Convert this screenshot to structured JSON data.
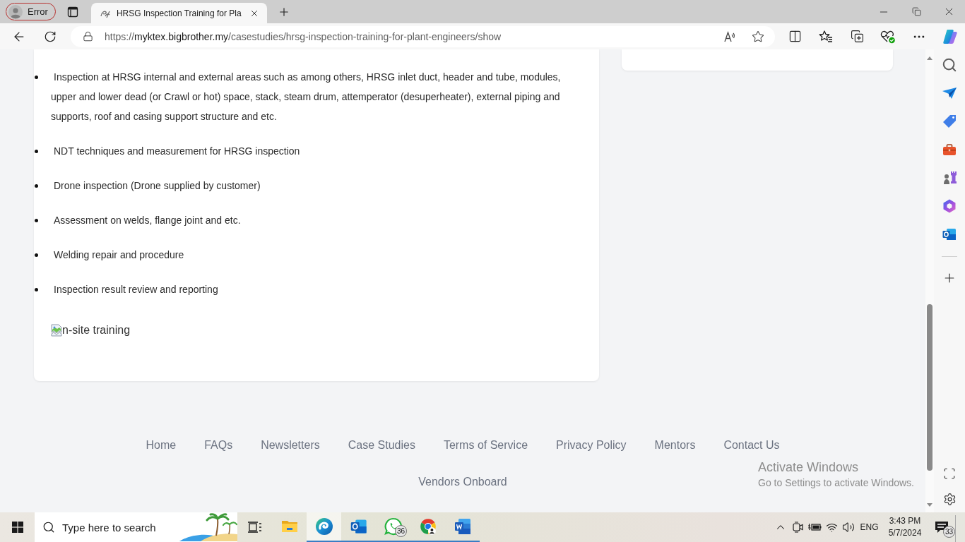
{
  "browser": {
    "profile": {
      "label": "Error",
      "alert": true
    },
    "tabs": [
      {
        "title": "HRSG Inspection Training for Pla",
        "selected": true
      }
    ],
    "address": {
      "scheme": "https://",
      "host": "myktex.bigbrother.my",
      "path": "/casestudies/hrsg-inspection-training-for-plant-engineers/show"
    }
  },
  "page": {
    "topics": [
      "Inspection at HRSG internal and external areas such as among others, HRSG inlet duct, header and tube, modules, upper and lower dead (or Crawl or hot) space, stack, steam drum, attemperator (desuperheater), external piping and supports, roof and casing support structure and etc.",
      "NDT techniques and measurement for HRSG inspection",
      "Drone inspection (Drone supplied by customer)",
      "Assessment on welds, flange joint and etc.",
      "Welding repair and procedure",
      "Inspection result review and reporting"
    ],
    "image_alt": "n-site training"
  },
  "footer": {
    "links": [
      "Home",
      "FAQs",
      "Newsletters",
      "Case Studies",
      "Terms of Service",
      "Privacy Policy",
      "Mentors",
      "Contact Us",
      "Vendors Onboard"
    ]
  },
  "windows_notice": {
    "title": "Activate Windows",
    "text": "Go to Settings to activate Windows."
  },
  "taskbar": {
    "search": {
      "placeholder": "Type here to search"
    },
    "apps": [
      {
        "kind": "folder",
        "running": false,
        "selected": false
      },
      {
        "kind": "wave",
        "running": true,
        "selected": true
      },
      {
        "kind": "mail",
        "running": true,
        "selected": false
      },
      {
        "kind": "chat",
        "running": true,
        "selected": false,
        "badge": "36"
      },
      {
        "kind": "ring",
        "running": true,
        "selected": false
      },
      {
        "kind": "doc",
        "running": true,
        "selected": false
      }
    ],
    "tray": {
      "language": "ENG",
      "time": "3:43 PM",
      "date": "5/7/2024",
      "notifications": "33"
    }
  }
}
